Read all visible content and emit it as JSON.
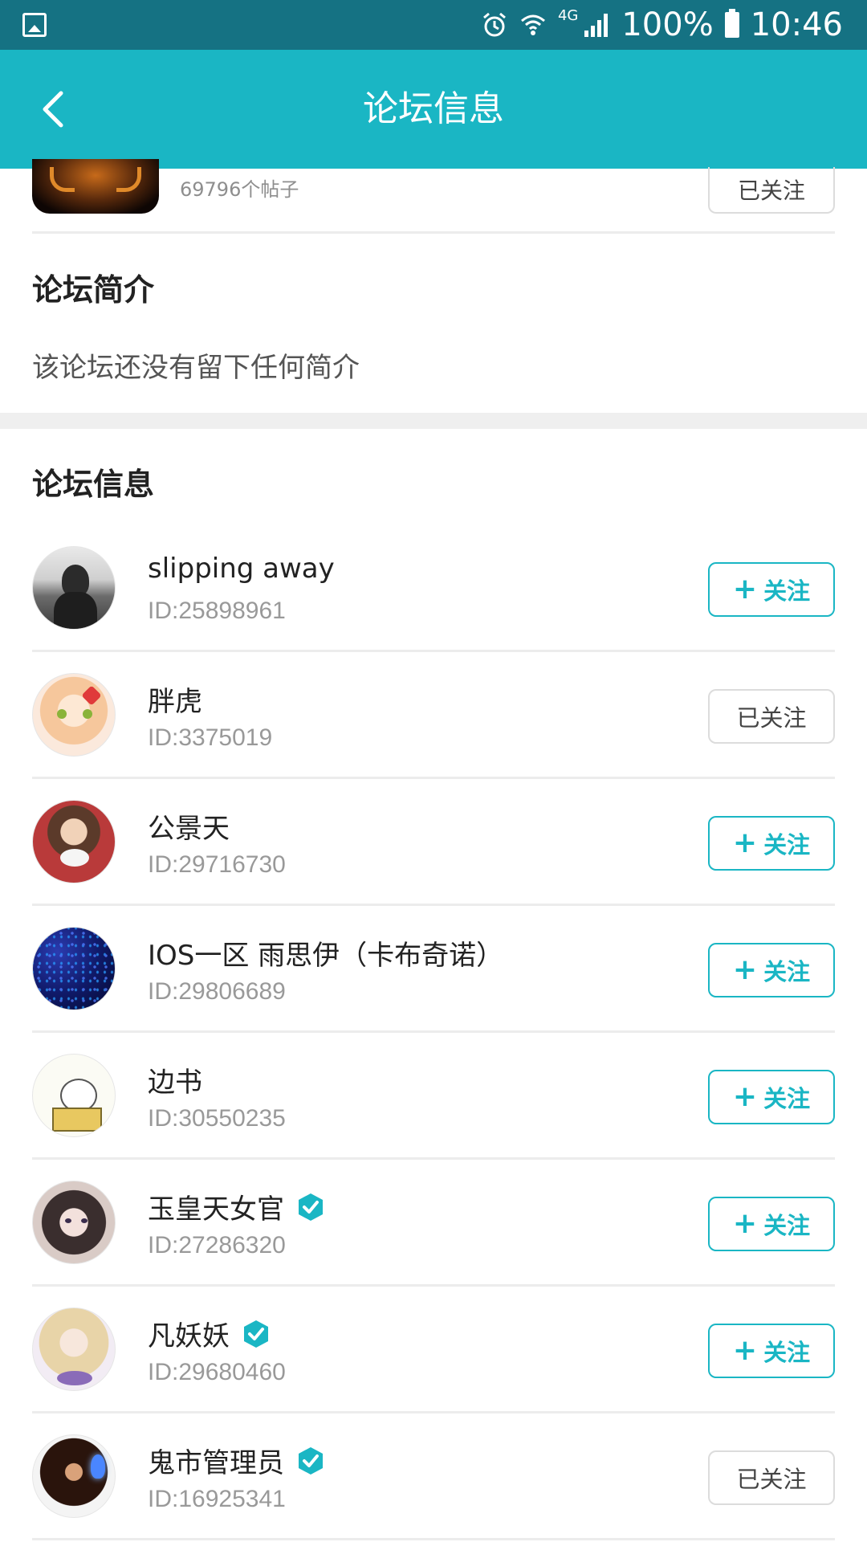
{
  "status_bar": {
    "network": "4G",
    "battery": "100%",
    "time": "10:46"
  },
  "header": {
    "title": "论坛信息"
  },
  "forum": {
    "post_count": "69796个帖子",
    "follow_status": "已关注"
  },
  "intro": {
    "title": "论坛简介",
    "text": "该论坛还没有留下任何简介"
  },
  "info": {
    "title": "论坛信息"
  },
  "follow_label": "关注",
  "followed_label": "已关注",
  "members": [
    {
      "name": "slipping away",
      "id": "ID:25898961",
      "followed": false,
      "verified": false
    },
    {
      "name": "胖虎",
      "id": "ID:3375019",
      "followed": true,
      "verified": false
    },
    {
      "name": "公景天",
      "id": "ID:29716730",
      "followed": false,
      "verified": false
    },
    {
      "name": "IOS一区 雨思伊（卡布奇诺）",
      "id": "ID:29806689",
      "followed": false,
      "verified": false
    },
    {
      "name": "边书",
      "id": "ID:30550235",
      "followed": false,
      "verified": false
    },
    {
      "name": "玉皇天女官",
      "id": "ID:27286320",
      "followed": false,
      "verified": true
    },
    {
      "name": "凡妖妖",
      "id": "ID:29680460",
      "followed": false,
      "verified": true
    },
    {
      "name": "鬼市管理员",
      "id": "ID:16925341",
      "followed": true,
      "verified": true
    }
  ],
  "colors": {
    "accent": "#1ab6c4",
    "status_bar": "#157283"
  }
}
